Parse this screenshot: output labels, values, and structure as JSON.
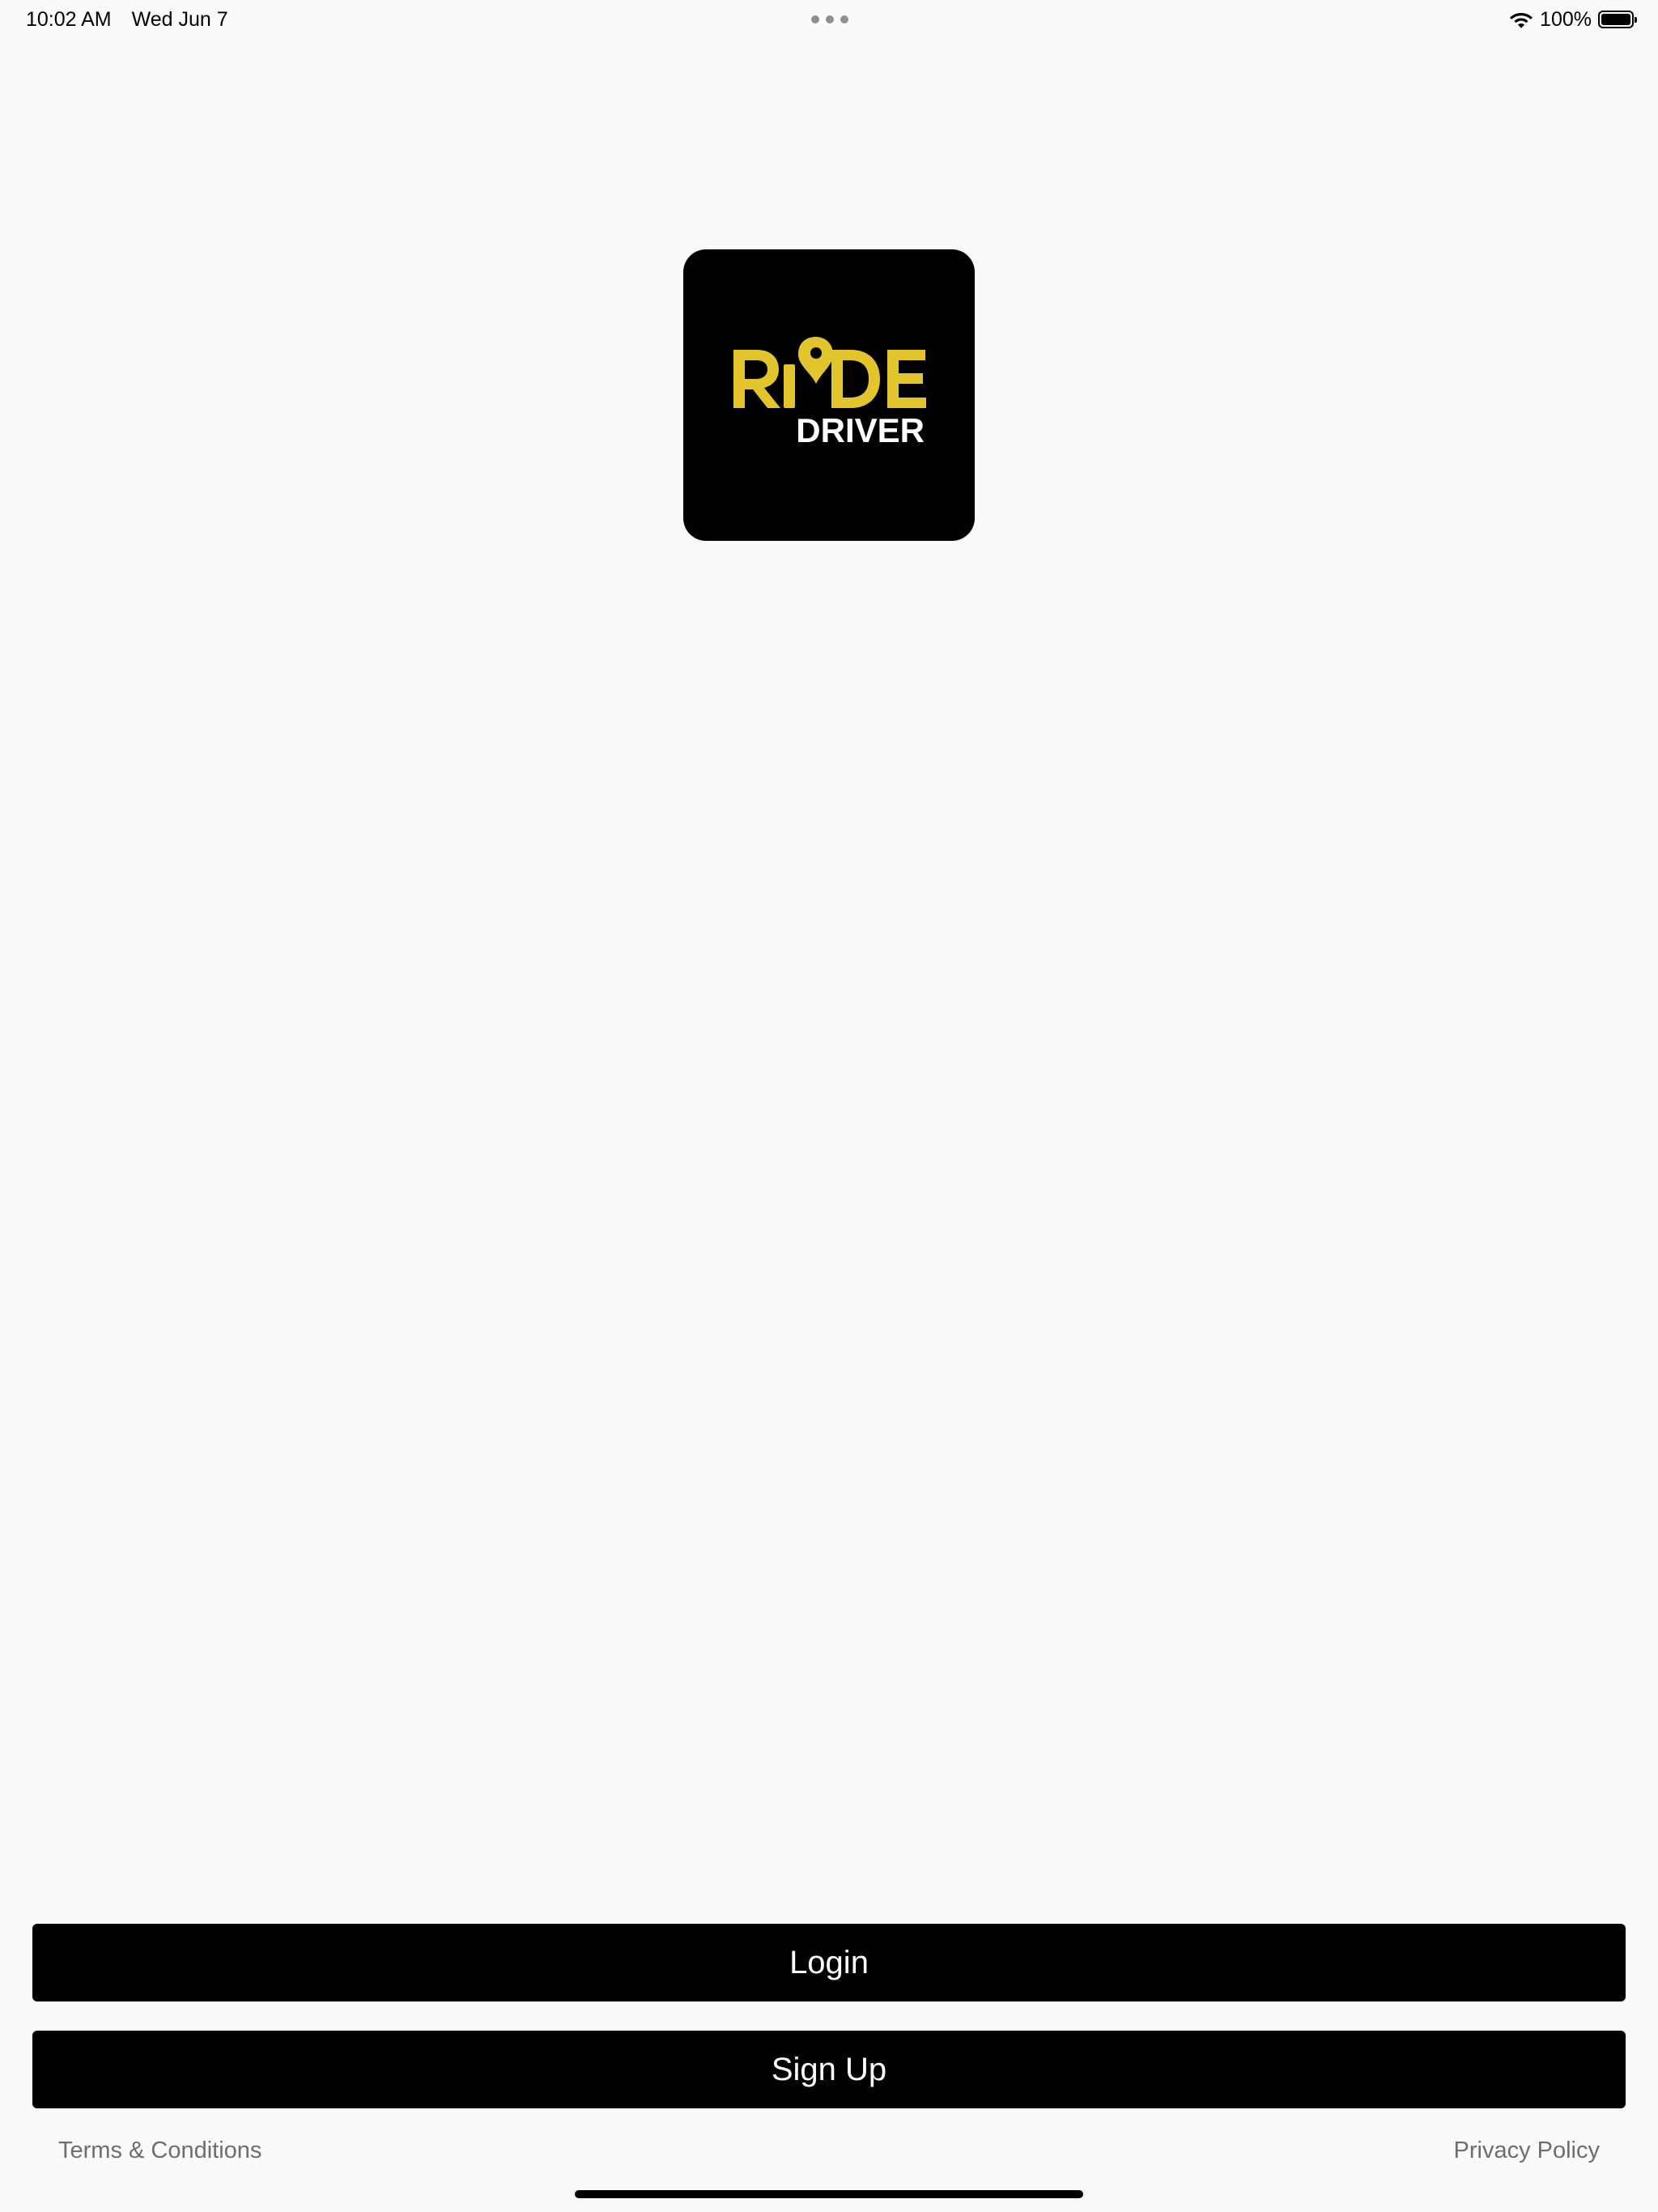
{
  "status_bar": {
    "time": "10:02 AM",
    "date": "Wed Jun 7",
    "battery_percent": "100%",
    "battery_level": 1.0,
    "icons": [
      "more-dots-icon",
      "wifi-icon",
      "battery-icon"
    ]
  },
  "logo": {
    "word_main": "RIDE",
    "word_sub": "DRIVER",
    "colors": {
      "background": "#000000",
      "accent": "#e2c42d",
      "sub_text": "#ffffff"
    }
  },
  "actions": {
    "login_label": "Login",
    "signup_label": "Sign Up"
  },
  "footer": {
    "terms_label": "Terms & Conditions",
    "privacy_label": "Privacy Policy"
  },
  "colors": {
    "page_background": "#fafafa",
    "button_background": "#000000",
    "button_text": "#ffffff",
    "link_text": "#6d6d72"
  }
}
